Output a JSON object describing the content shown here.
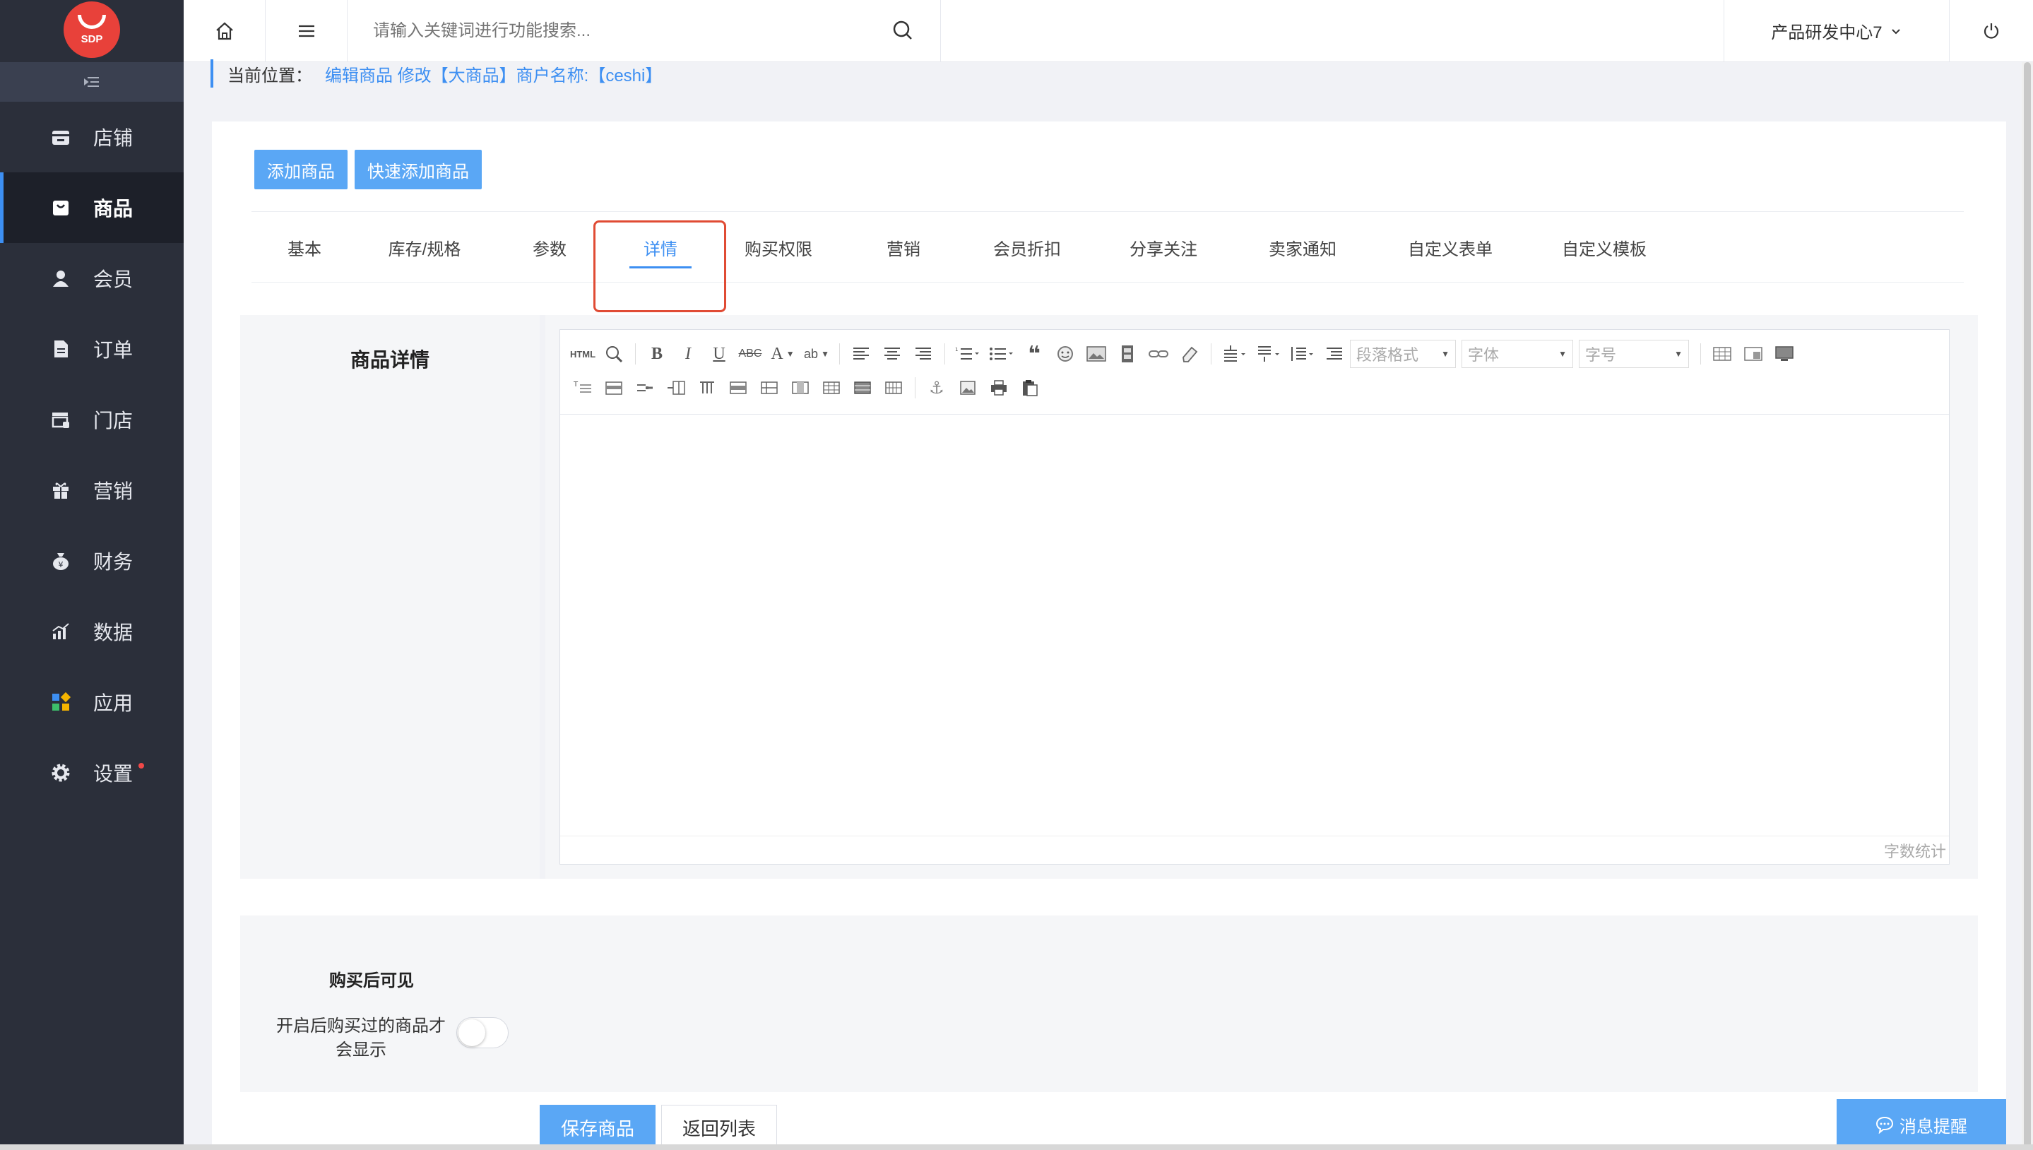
{
  "sidebar": {
    "logo_text": "SDP",
    "items": [
      {
        "label": "店铺",
        "icon": "store-icon"
      },
      {
        "label": "商品",
        "icon": "bag-icon"
      },
      {
        "label": "会员",
        "icon": "user-icon"
      },
      {
        "label": "订单",
        "icon": "document-icon"
      },
      {
        "label": "门店",
        "icon": "shop-icon"
      },
      {
        "label": "营销",
        "icon": "gift-icon"
      },
      {
        "label": "财务",
        "icon": "money-bag-icon"
      },
      {
        "label": "数据",
        "icon": "bar-chart-icon"
      },
      {
        "label": "应用",
        "icon": "apps-icon"
      },
      {
        "label": "设置",
        "icon": "gear-icon"
      }
    ],
    "active_index": 1
  },
  "topbar": {
    "search_placeholder": "请输入关键词进行功能搜索...",
    "org_name": "产品研发中心7"
  },
  "breadcrumb": {
    "label": "当前位置：",
    "path": "编辑商品  修改【大商品】商户名称:【ceshi】"
  },
  "actions": {
    "add_product": "添加商品",
    "quick_add_product": "快速添加商品"
  },
  "tabs": [
    {
      "label": "基本"
    },
    {
      "label": "库存/规格"
    },
    {
      "label": "参数"
    },
    {
      "label": "详情"
    },
    {
      "label": "购买权限"
    },
    {
      "label": "营销"
    },
    {
      "label": "会员折扣"
    },
    {
      "label": "分享关注"
    },
    {
      "label": "卖家通知"
    },
    {
      "label": "自定义表单"
    },
    {
      "label": "自定义模板"
    }
  ],
  "active_tab": "详情",
  "detail": {
    "label": "商品详情",
    "toolbar": {
      "paragraph_format": "段落格式",
      "font_family": "字体",
      "font_size": "字号",
      "html_label": "HTML"
    },
    "word_count": "字数统计"
  },
  "visibility": {
    "title": "购买后可见",
    "description": "开启后购买过的商品才会显示",
    "enabled": false
  },
  "footer": {
    "save": "保存商品",
    "back": "返回列表",
    "messages": "消息提醒"
  },
  "colors": {
    "sidebar_bg": "#2b2f3a",
    "accent": "#3d8ff2",
    "button_blue": "#5aa7f5",
    "highlight": "#e04b34",
    "logo_red": "#e8413a"
  }
}
